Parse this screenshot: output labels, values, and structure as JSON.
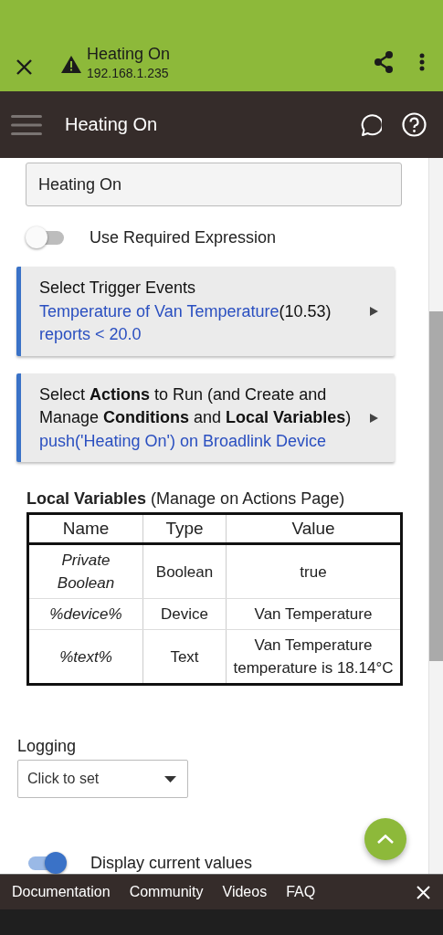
{
  "browser_bar": {
    "title": "Heating On",
    "address": "192.168.1.235"
  },
  "app_bar": {
    "title": "Heating On"
  },
  "name_field": {
    "value": "Heating On"
  },
  "required_expression": {
    "label": "Use Required Expression",
    "on": false
  },
  "sections": [
    {
      "title": "Select Trigger Events",
      "summary": [
        {
          "text": "Temperature of Van Temperature",
          "kind": "link"
        },
        {
          "text": "(10.53)",
          "kind": "plain"
        },
        {
          "text": " reports < 20.0",
          "kind": "link"
        }
      ]
    },
    {
      "title": "Select **Actions** to Run (and Create and Manage **Conditions** and **Local Variables**)",
      "summary": [
        {
          "text": "push('Heating On') on Broadlink Device",
          "kind": "link"
        }
      ]
    }
  ],
  "local_variables": {
    "heading": "**Local Variables** (Manage on Actions Page)",
    "columns": [
      "Name",
      "Type",
      "Value"
    ],
    "rows": [
      {
        "name": "Private Boolean",
        "type": "Boolean",
        "value": "true"
      },
      {
        "name": "%device%",
        "type": "Device",
        "value": "Van Temperature"
      },
      {
        "name": "%text%",
        "type": "Text",
        "value": "Van Temperature temperature is 18.14°C"
      }
    ]
  },
  "logging": {
    "label": "Logging",
    "placeholder": "Click to set"
  },
  "display_values": {
    "label": "Display current values",
    "on": true
  },
  "footer": {
    "links": [
      "Documentation",
      "Community",
      "Videos",
      "FAQ"
    ]
  }
}
